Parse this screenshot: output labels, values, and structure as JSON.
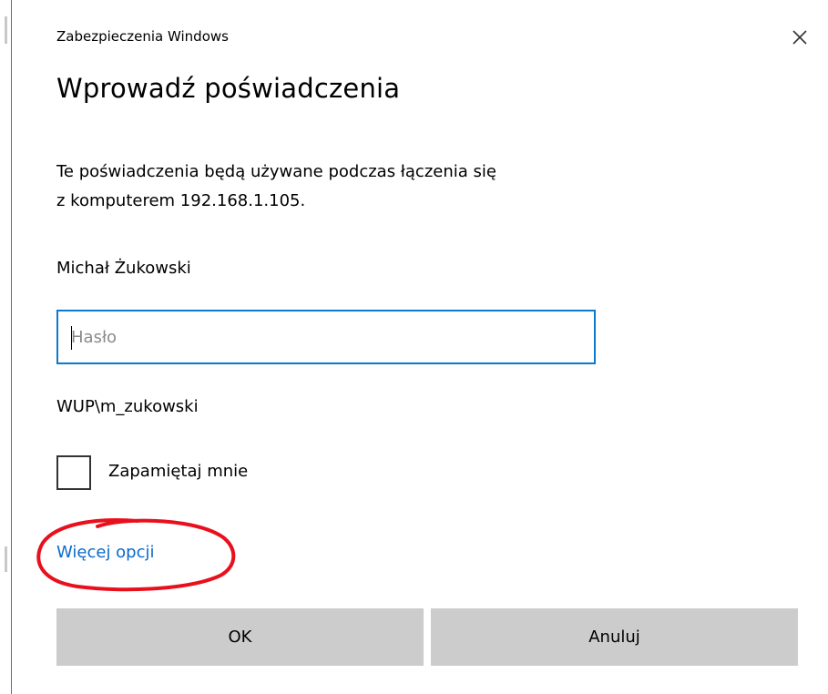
{
  "window": {
    "title": "Zabezpieczenia Windows",
    "close_icon": "close-icon"
  },
  "dialog": {
    "heading": "Wprowadź poświadczenia",
    "description_line1": "Te poświadczenia będą używane podczas łączenia się",
    "description_line2": "z komputerem 192.168.1.105.",
    "user_display_name": "Michał Żukowski",
    "password_field": {
      "value": "",
      "placeholder": "Hasło"
    },
    "domain_user": "WUP\\m_zukowski",
    "remember_me": {
      "label": "Zapamiętaj mnie",
      "checked": false
    },
    "more_options_link": "Więcej opcji",
    "ok_button": "OK",
    "cancel_button": "Anuluj"
  },
  "colors": {
    "accent": "#0a7ad1",
    "link": "#0b6ac9",
    "button_bg": "#cccccc",
    "annotation_red": "#e8101c"
  }
}
